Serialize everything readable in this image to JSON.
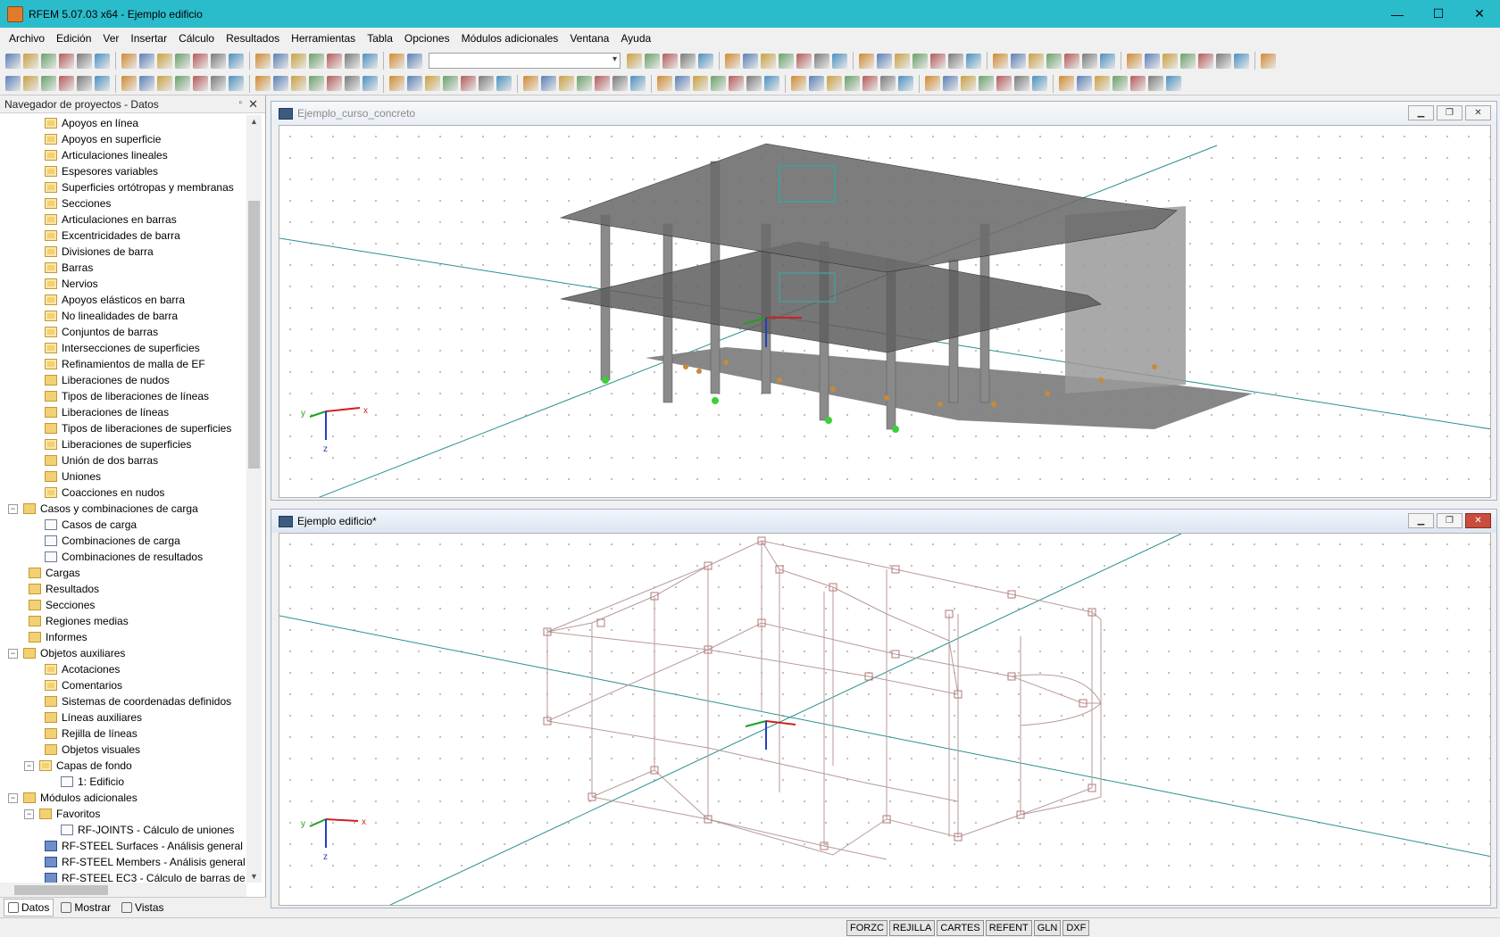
{
  "window": {
    "title": "RFEM 5.07.03 x64 - Ejemplo edificio",
    "min": "—",
    "max": "☐",
    "close": "✕"
  },
  "menu": [
    "Archivo",
    "Edición",
    "Ver",
    "Insertar",
    "Cálculo",
    "Resultados",
    "Herramientas",
    "Tabla",
    "Opciones",
    "Módulos adicionales",
    "Ventana",
    "Ayuda"
  ],
  "navigator": {
    "title": "Navegador de proyectos - Datos",
    "pin": "▫",
    "close": "✕",
    "items": [
      {
        "label": "Apoyos en línea",
        "level": 2,
        "icon": "fold2"
      },
      {
        "label": "Apoyos en superficie",
        "level": 2,
        "icon": "fold2"
      },
      {
        "label": "Articulaciones lineales",
        "level": 2,
        "icon": "fold2"
      },
      {
        "label": "Espesores variables",
        "level": 2,
        "icon": "fold2"
      },
      {
        "label": "Superficies ortótropas y membranas",
        "level": 2,
        "icon": "fold2"
      },
      {
        "label": "Secciones",
        "level": 2,
        "icon": "fold2"
      },
      {
        "label": "Articulaciones en barras",
        "level": 2,
        "icon": "fold2"
      },
      {
        "label": "Excentricidades de barra",
        "level": 2,
        "icon": "fold2"
      },
      {
        "label": "Divisiones de barra",
        "level": 2,
        "icon": "fold2"
      },
      {
        "label": "Barras",
        "level": 2,
        "icon": "fold2"
      },
      {
        "label": "Nervios",
        "level": 2,
        "icon": "fold2"
      },
      {
        "label": "Apoyos elásticos en barra",
        "level": 2,
        "icon": "fold2"
      },
      {
        "label": "No linealidades de barra",
        "level": 2,
        "icon": "fold2"
      },
      {
        "label": "Conjuntos de barras",
        "level": 2,
        "icon": "fold2"
      },
      {
        "label": "Intersecciones de superficies",
        "level": 2,
        "icon": "fold2"
      },
      {
        "label": "Refinamientos de malla de EF",
        "level": 2,
        "icon": "fold2"
      },
      {
        "label": "Liberaciones de nudos",
        "level": 2,
        "icon": "fold"
      },
      {
        "label": "Tipos de liberaciones de líneas",
        "level": 2,
        "icon": "fold"
      },
      {
        "label": "Liberaciones de líneas",
        "level": 2,
        "icon": "fold"
      },
      {
        "label": "Tipos de liberaciones de superficies",
        "level": 2,
        "icon": "fold"
      },
      {
        "label": "Liberaciones de superficies",
        "level": 2,
        "icon": "fold2"
      },
      {
        "label": "Unión de dos barras",
        "level": 2,
        "icon": "fold"
      },
      {
        "label": "Uniones",
        "level": 2,
        "icon": "fold"
      },
      {
        "label": "Coacciones en nudos",
        "level": 2,
        "icon": "fold2"
      },
      {
        "label": "Casos y combinaciones de carga",
        "level": 1,
        "icon": "fold",
        "exp": "−"
      },
      {
        "label": "Casos de carga",
        "level": 2,
        "icon": "doc"
      },
      {
        "label": "Combinaciones de carga",
        "level": 2,
        "icon": "doc"
      },
      {
        "label": "Combinaciones de resultados",
        "level": 2,
        "icon": "doc"
      },
      {
        "label": "Cargas",
        "level": 1,
        "icon": "fold"
      },
      {
        "label": "Resultados",
        "level": 1,
        "icon": "fold"
      },
      {
        "label": "Secciones",
        "level": 1,
        "icon": "fold"
      },
      {
        "label": "Regiones medias",
        "level": 1,
        "icon": "fold"
      },
      {
        "label": "Informes",
        "level": 1,
        "icon": "fold"
      },
      {
        "label": "Objetos auxiliares",
        "level": 1,
        "icon": "fold",
        "exp": "−"
      },
      {
        "label": "Acotaciones",
        "level": 2,
        "icon": "fold2"
      },
      {
        "label": "Comentarios",
        "level": 2,
        "icon": "fold2"
      },
      {
        "label": "Sistemas de coordenadas definidos",
        "level": 2,
        "icon": "fold"
      },
      {
        "label": "Líneas auxiliares",
        "level": 2,
        "icon": "fold"
      },
      {
        "label": "Rejilla de líneas",
        "level": 2,
        "icon": "fold"
      },
      {
        "label": "Objetos visuales",
        "level": 2,
        "icon": "fold"
      },
      {
        "label": "Capas de fondo",
        "level": 2,
        "icon": "fold2",
        "exp": "−"
      },
      {
        "label": "1: Edificio",
        "level": 3,
        "icon": "doc"
      },
      {
        "label": "Módulos adicionales",
        "level": 1,
        "icon": "fold",
        "exp": "−"
      },
      {
        "label": "Favoritos",
        "level": 2,
        "icon": "fold",
        "exp": "−"
      },
      {
        "label": "RF-JOINTS - Cálculo de uniones",
        "level": 3,
        "icon": "doc"
      },
      {
        "label": "RF-STEEL Surfaces - Análisis general",
        "level": 2,
        "icon": "blue"
      },
      {
        "label": "RF-STEEL Members - Análisis general",
        "level": 2,
        "icon": "blue"
      },
      {
        "label": "RF-STEEL EC3 - Cálculo de barras de",
        "level": 2,
        "icon": "blue"
      }
    ],
    "tabs": [
      "Datos",
      "Mostrar",
      "Vistas"
    ]
  },
  "viewports": [
    {
      "title": "Ejemplo_curso_concreto",
      "active": false
    },
    {
      "title": "Ejemplo edificio*",
      "active": true
    }
  ],
  "axes": {
    "x": "x",
    "y": "y",
    "z": "z"
  },
  "status_buttons": [
    "FORZC",
    "REJILLA",
    "CARTES",
    "REFENT",
    "GLN",
    "DXF"
  ],
  "colors": {
    "titlebar": "#2bbccc",
    "model_fill": "#6e6e6e",
    "wire": "#b89a9a",
    "axis_x": "#d02020",
    "axis_y": "#20a020",
    "axis_z": "#2040c0"
  }
}
